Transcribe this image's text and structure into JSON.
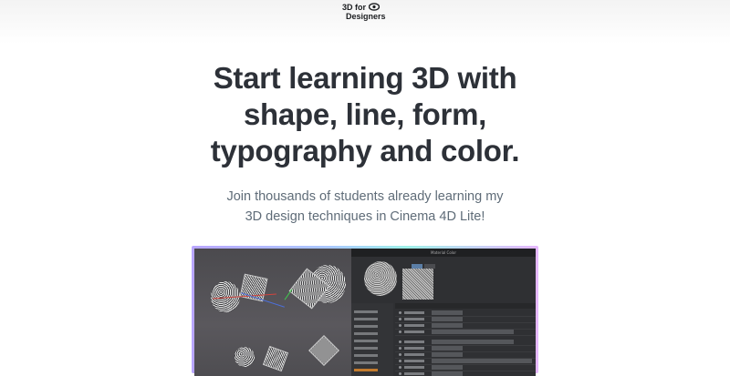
{
  "header": {
    "logo_line1": "3D for",
    "logo_line2": "Designers"
  },
  "hero": {
    "headline_lines": [
      "Start learning 3D with",
      "shape, line, form,",
      "typography and color."
    ],
    "subtext_lines": [
      "Join thousands of students already learning my",
      "3D design techniques in Cinema 4D Lite!"
    ]
  },
  "preview": {
    "panel_title": "Material Color",
    "colors": {
      "frame_gradient": [
        "#b9a6ff",
        "#a9c8ff",
        "#9ff0e8",
        "#e6b7ff"
      ],
      "accent_tab": "#5b7ea6",
      "selected_item": "#c37b2e"
    }
  }
}
